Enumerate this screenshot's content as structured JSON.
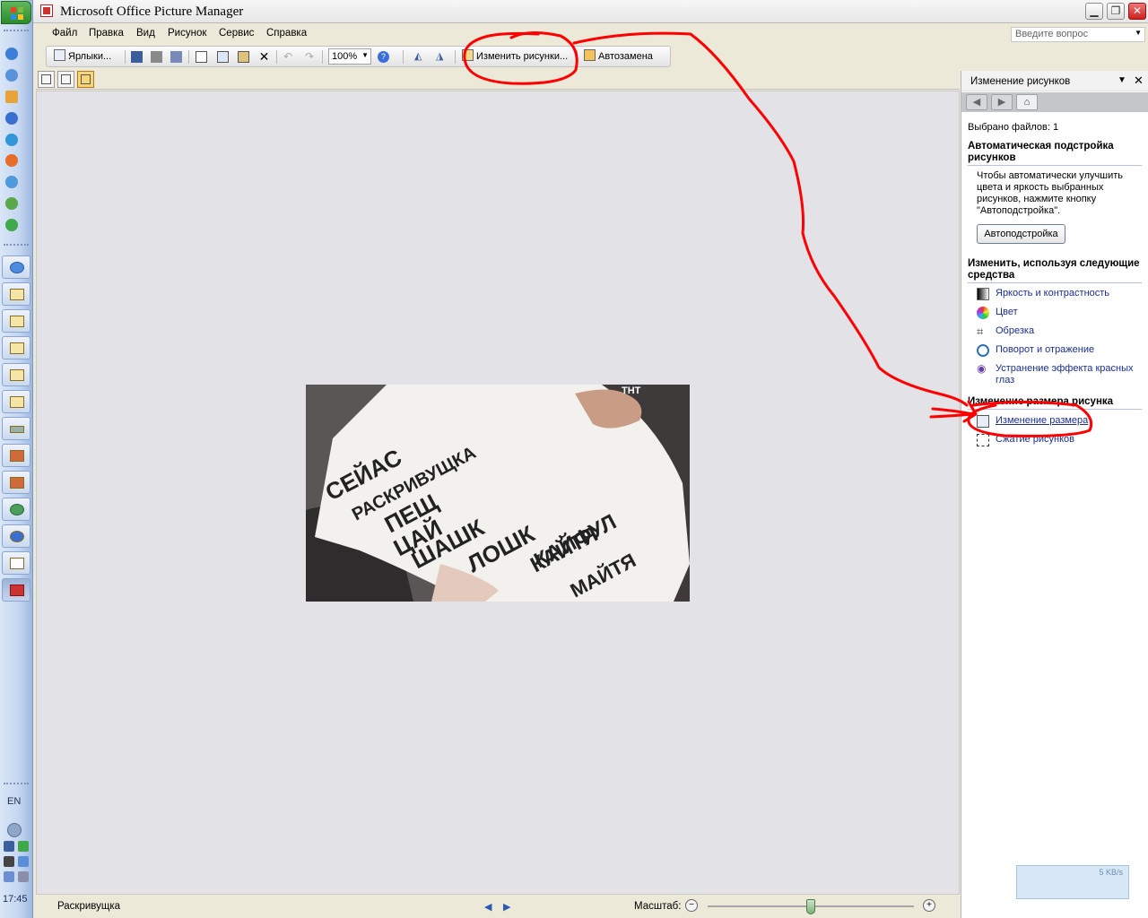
{
  "window": {
    "title": "Microsoft Office Picture Manager",
    "minimize_icon": "minimize-icon",
    "restore_icon": "restore-icon",
    "close_icon": "close-icon"
  },
  "menu": {
    "items": [
      "Файл",
      "Правка",
      "Вид",
      "Рисунок",
      "Сервис",
      "Справка"
    ],
    "help_placeholder": "Введите вопрос"
  },
  "toolbar": {
    "shortcuts_label": "Ярлыки...",
    "zoom_value": "100%",
    "edit_pictures_label": "Изменить рисунки...",
    "autofix_label": "Автозамена"
  },
  "taskpane": {
    "title": "Изменение рисунков",
    "selected_files": "Выбрано файлов: 1",
    "autofix_section": "Автоматическая подстройка рисунков",
    "autofix_desc": "Чтобы автоматически улучшить цвета и яркость выбранных рисунков, нажмите кнопку \"Автоподстройка\".",
    "autofix_button": "Автоподстройка",
    "tools_section": "Изменить, используя следующие средства",
    "tools": [
      {
        "label": "Яркость и контрастность",
        "icon": "brightness-icon"
      },
      {
        "label": "Цвет",
        "icon": "color-icon"
      },
      {
        "label": "Обрезка",
        "icon": "crop-icon"
      },
      {
        "label": "Поворот и отражение",
        "icon": "rotate-icon"
      },
      {
        "label": "Устранение эффекта красных глаз",
        "icon": "redeye-icon"
      }
    ],
    "resize_section": "Изменение размера рисунка",
    "resize_tools": [
      {
        "label": "Изменение размера",
        "icon": "resize-icon"
      },
      {
        "label": "Сжатие рисунков",
        "icon": "compress-icon"
      }
    ]
  },
  "status": {
    "filename": "Раскривущка",
    "zoom_label": "Масштаб:",
    "zoom_level": 0.5
  },
  "photo": {
    "watermark": "ТНТ",
    "lines": [
      "СЕЙАС",
      "РАСКРИВУЩКА",
      "ПЕЩ",
      "ЦАЙ",
      "ШАШК",
      "ЛОШК",
      "КАЙФУЛ",
      "КАЙТЯ",
      "МАЙТЯ"
    ]
  },
  "taskbar": {
    "language": "EN",
    "time": "17:45"
  },
  "network_widget": {
    "speed": "5 KB/s"
  },
  "colors": {
    "annotation": "#FF0000",
    "canvas": "#E3E2E6",
    "link": "#1A2F8A"
  }
}
